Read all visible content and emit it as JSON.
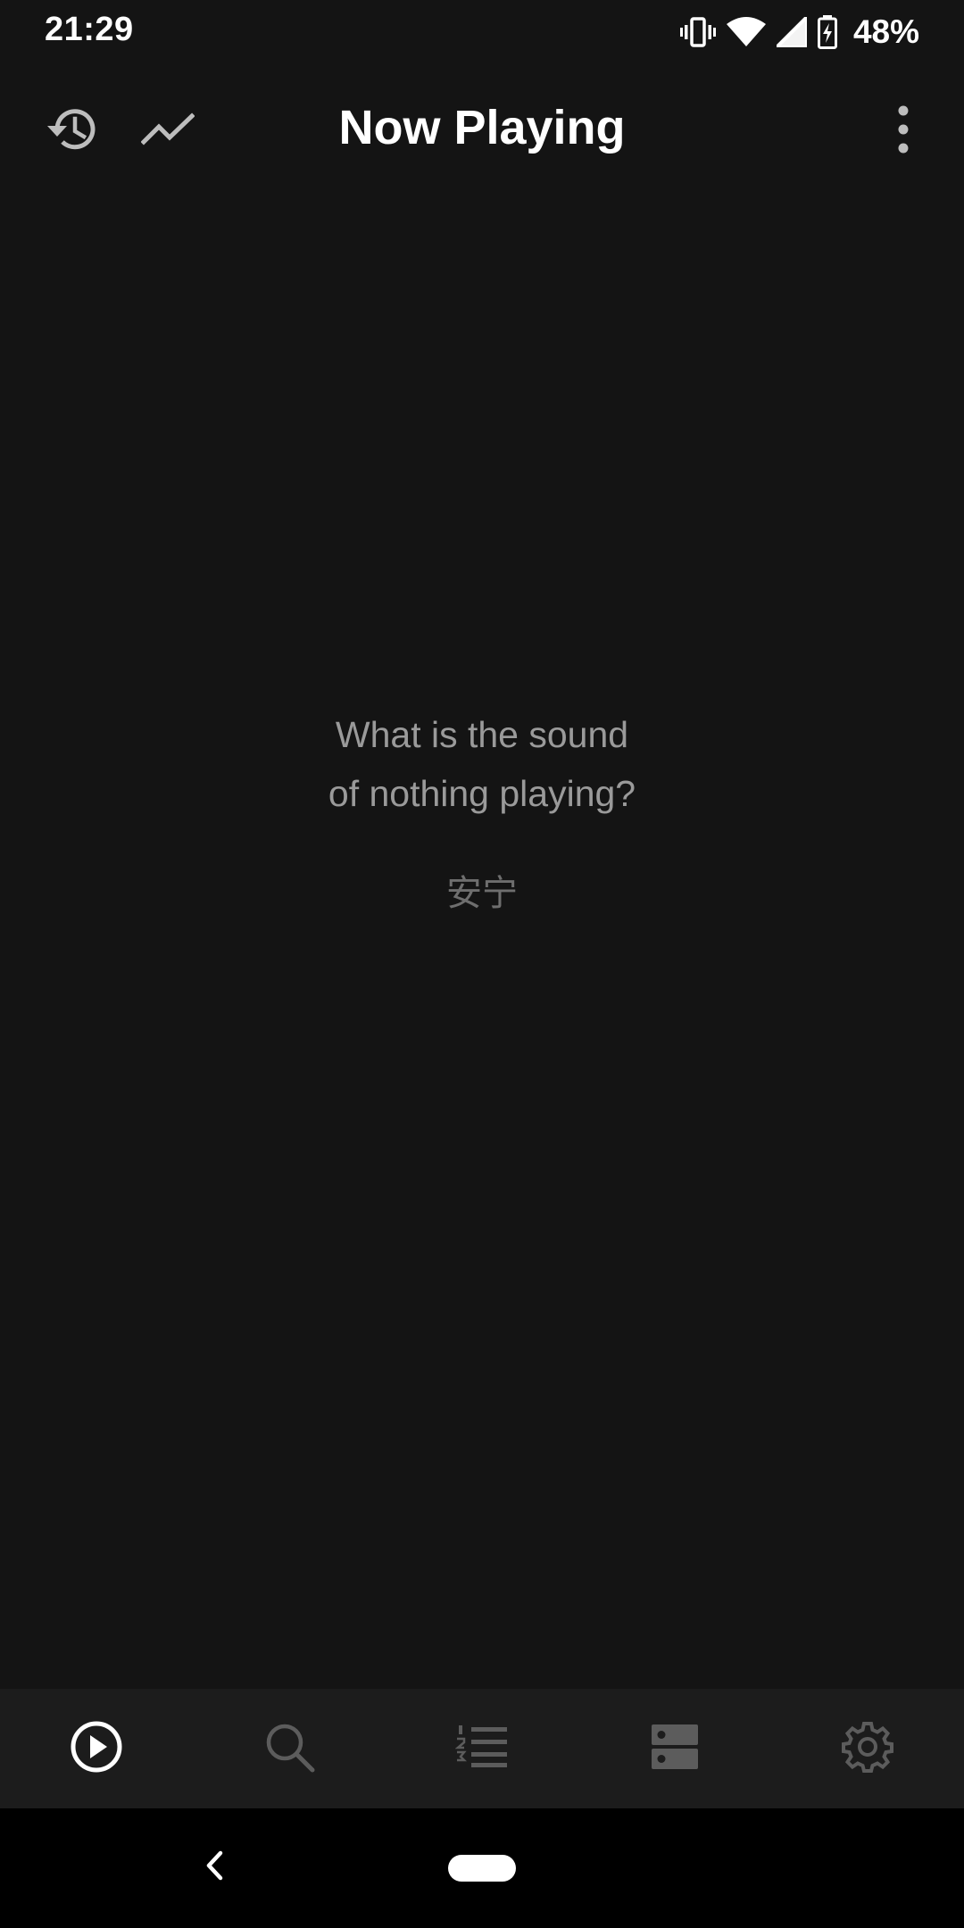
{
  "status_bar": {
    "time": "21:29",
    "battery_percent": "48%",
    "icons": [
      "vibrate-icon",
      "wifi-icon",
      "cell-signal-icon",
      "battery-charging-icon"
    ]
  },
  "app_bar": {
    "title": "Now Playing",
    "left_icons": [
      "history-icon",
      "trending-icon"
    ],
    "right_icon": "more-vert-icon"
  },
  "empty_state": {
    "line1": "What is the sound",
    "line2": "of nothing playing?",
    "caption": "安宁"
  },
  "bottom_nav": {
    "items": [
      {
        "icon": "play-circle-icon",
        "active": true
      },
      {
        "icon": "search-icon",
        "active": false
      },
      {
        "icon": "queue-list-icon",
        "active": false
      },
      {
        "icon": "library-icon",
        "active": false
      },
      {
        "icon": "settings-icon",
        "active": false
      }
    ]
  },
  "colors": {
    "background": "#141414",
    "bottom_nav_bg": "#1c1c1c",
    "active_icon": "#ffffff",
    "inactive_icon": "#5c5c5c",
    "muted_text": "#9a9a9a"
  }
}
